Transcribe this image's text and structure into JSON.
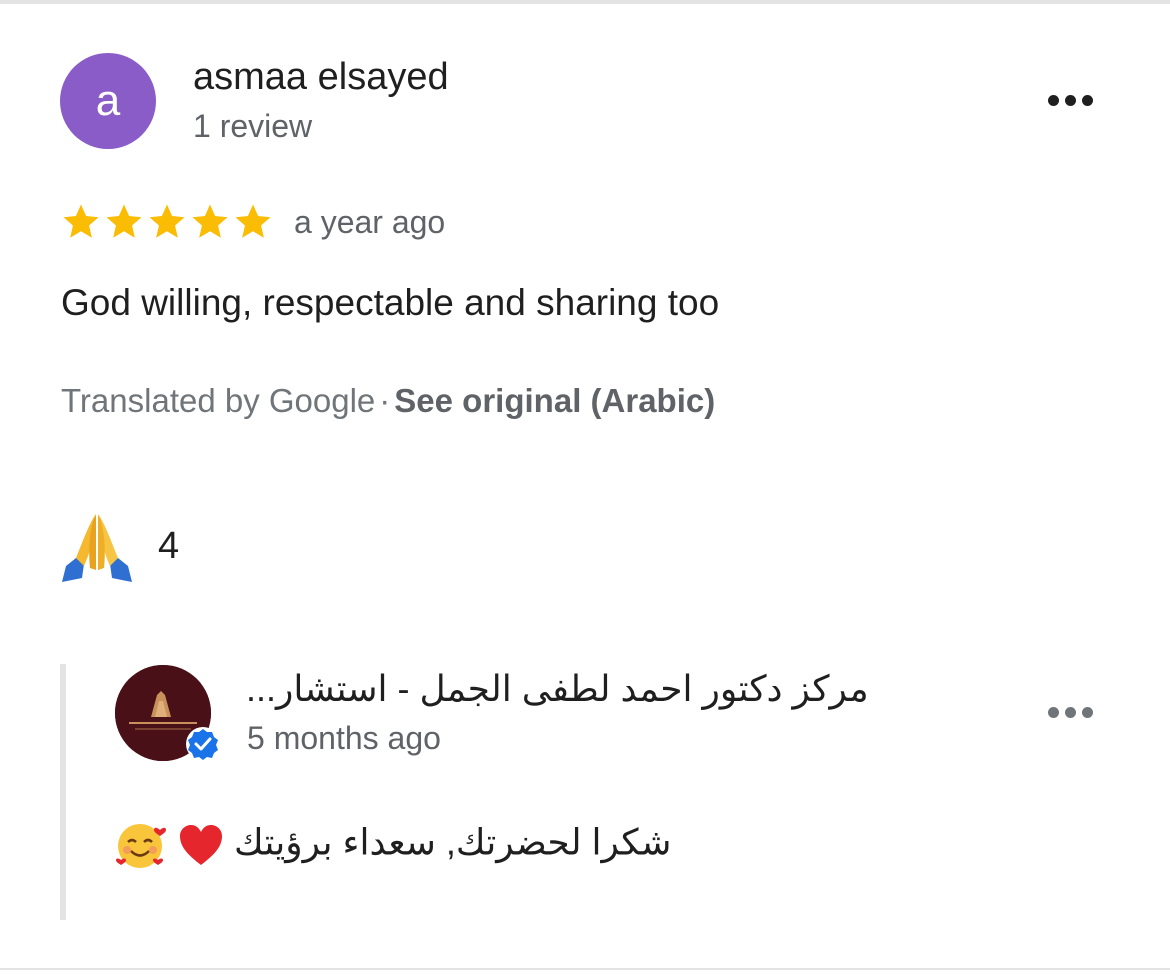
{
  "review": {
    "avatar_letter": "a",
    "avatar_color": "#8a5cc8",
    "reviewer_name": "asmaa elsayed",
    "review_count": "1 review",
    "rating": 5,
    "rating_max": 5,
    "star_color": "#fbbc04",
    "time": "a year ago",
    "text": "God willing, respectable and sharing too",
    "translated_label": "Translated by Google",
    "separator": "·",
    "see_original": "See original (Arabic)",
    "more_icon": "more-horizontal-icon"
  },
  "reaction": {
    "icon": "folded-hands-emoji",
    "count": "4"
  },
  "owner_reply": {
    "owner_name": "مركز دكتور احمد لطفى الجمل - استشار...",
    "verified_icon": "verified-badge-icon",
    "verified_color": "#1a73e8",
    "time": "5 months ago",
    "text": "شكرا لحضرتك, سعداء برؤيتك",
    "emojis": [
      "red-heart-emoji",
      "smiling-face-with-hearts-emoji"
    ],
    "more_icon": "more-horizontal-icon"
  }
}
